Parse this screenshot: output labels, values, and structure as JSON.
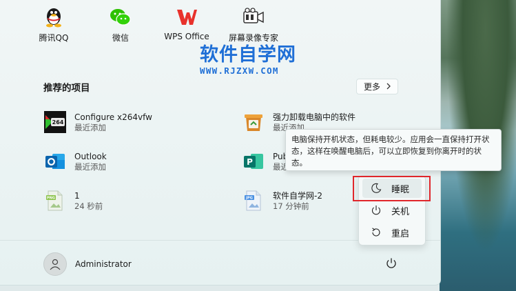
{
  "pinned_apps": [
    {
      "label": "腾讯QQ",
      "icon": "qq-penguin-icon"
    },
    {
      "label": "微信",
      "icon": "wechat-icon"
    },
    {
      "label": "WPS Office",
      "icon": "wps-office-icon"
    },
    {
      "label": "屏幕录像专家",
      "icon": "screen-recorder-icon"
    }
  ],
  "watermark": {
    "title": "软件自学网",
    "url": "WWW.RJZXW.COM"
  },
  "recommended": {
    "title": "推荐的项目",
    "more_label": "更多",
    "items": [
      {
        "name": "Configure x264vfw",
        "sub": "最近添加",
        "icon": "x264-icon"
      },
      {
        "name": "强力卸载电脑中的软件",
        "sub": "最近添加",
        "icon": "uninstaller-icon"
      },
      {
        "name": "Outlook",
        "sub": "最近添加",
        "icon": "outlook-icon"
      },
      {
        "name": "Pub",
        "sub": "最近添加",
        "icon": "publisher-icon"
      },
      {
        "name": "1",
        "sub": "24 秒前",
        "icon": "png-file-icon"
      },
      {
        "name": "软件自学网-2",
        "sub": "17 分钟前",
        "icon": "jpg-file-icon"
      }
    ]
  },
  "user": {
    "name": "Administrator"
  },
  "tooltip": {
    "text": "电脑保持开机状态，但耗电较少。应用会一直保持打开状态，这样在唤醒电脑后，可以立即恢复到你离开时的状态。"
  },
  "power_menu": {
    "items": [
      {
        "label": "睡眠",
        "icon": "sleep-moon-icon"
      },
      {
        "label": "关机",
        "icon": "shutdown-icon"
      },
      {
        "label": "重启",
        "icon": "restart-icon"
      }
    ],
    "selected": "睡眠"
  },
  "colors": {
    "highlight_box": "#e0262b",
    "watermark": "#1f6fd6"
  }
}
